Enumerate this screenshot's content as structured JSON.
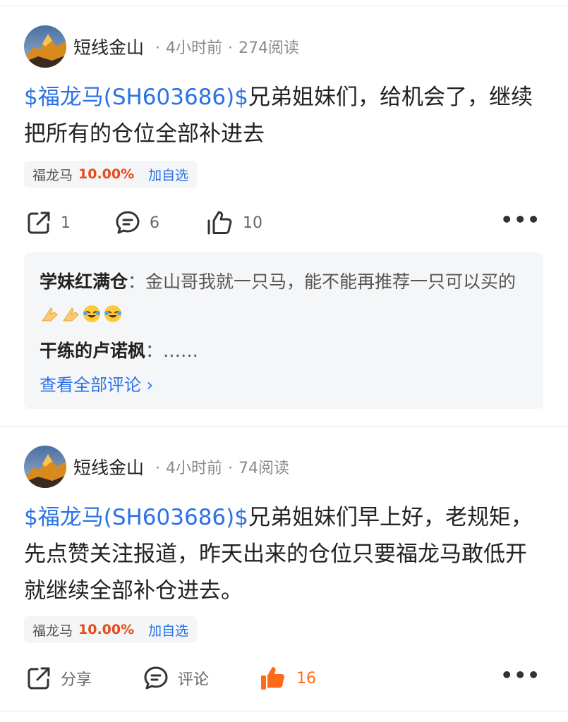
{
  "posts": [
    {
      "author": "短线金山",
      "time": "4小时前",
      "reads": "274阅读",
      "stock_link": "$福龙马(SH603686)$",
      "text": "兄弟姐妹们，给机会了，继续把所有的仓位全部补进去",
      "chip": {
        "name": "福龙马",
        "change": "10.00%",
        "add": "加自选"
      },
      "share_label": "1",
      "comment_label": "6",
      "like_label": "10",
      "comments": [
        {
          "name": "学妹红满仓",
          "sep": "：",
          "text": "金山哥我就一只马，能不能再推荐一只可以买的",
          "emojis": [
            "pray-emoji",
            "pray-emoji",
            "laugh-cry-emoji",
            "laugh-cry-emoji"
          ]
        },
        {
          "name": "干练的卢诺枫",
          "sep": "：",
          "text": "……"
        }
      ],
      "view_all": "查看全部评论 ›"
    },
    {
      "author": "短线金山",
      "time": "4小时前",
      "reads": "74阅读",
      "stock_link": "$福龙马(SH603686)$",
      "text": "兄弟姐妹们早上好，老规矩，先点赞关注报道，昨天出来的仓位只要福龙马敢低开就继续全部补仓进去。",
      "chip": {
        "name": "福龙马",
        "change": "10.00%",
        "add": "加自选"
      },
      "share_label": "分享",
      "comment_label": "评论",
      "like_label": "16"
    }
  ],
  "colors": {
    "link": "#2b72e6",
    "rise": "#e64a19",
    "liked": "#ff6a1a"
  }
}
